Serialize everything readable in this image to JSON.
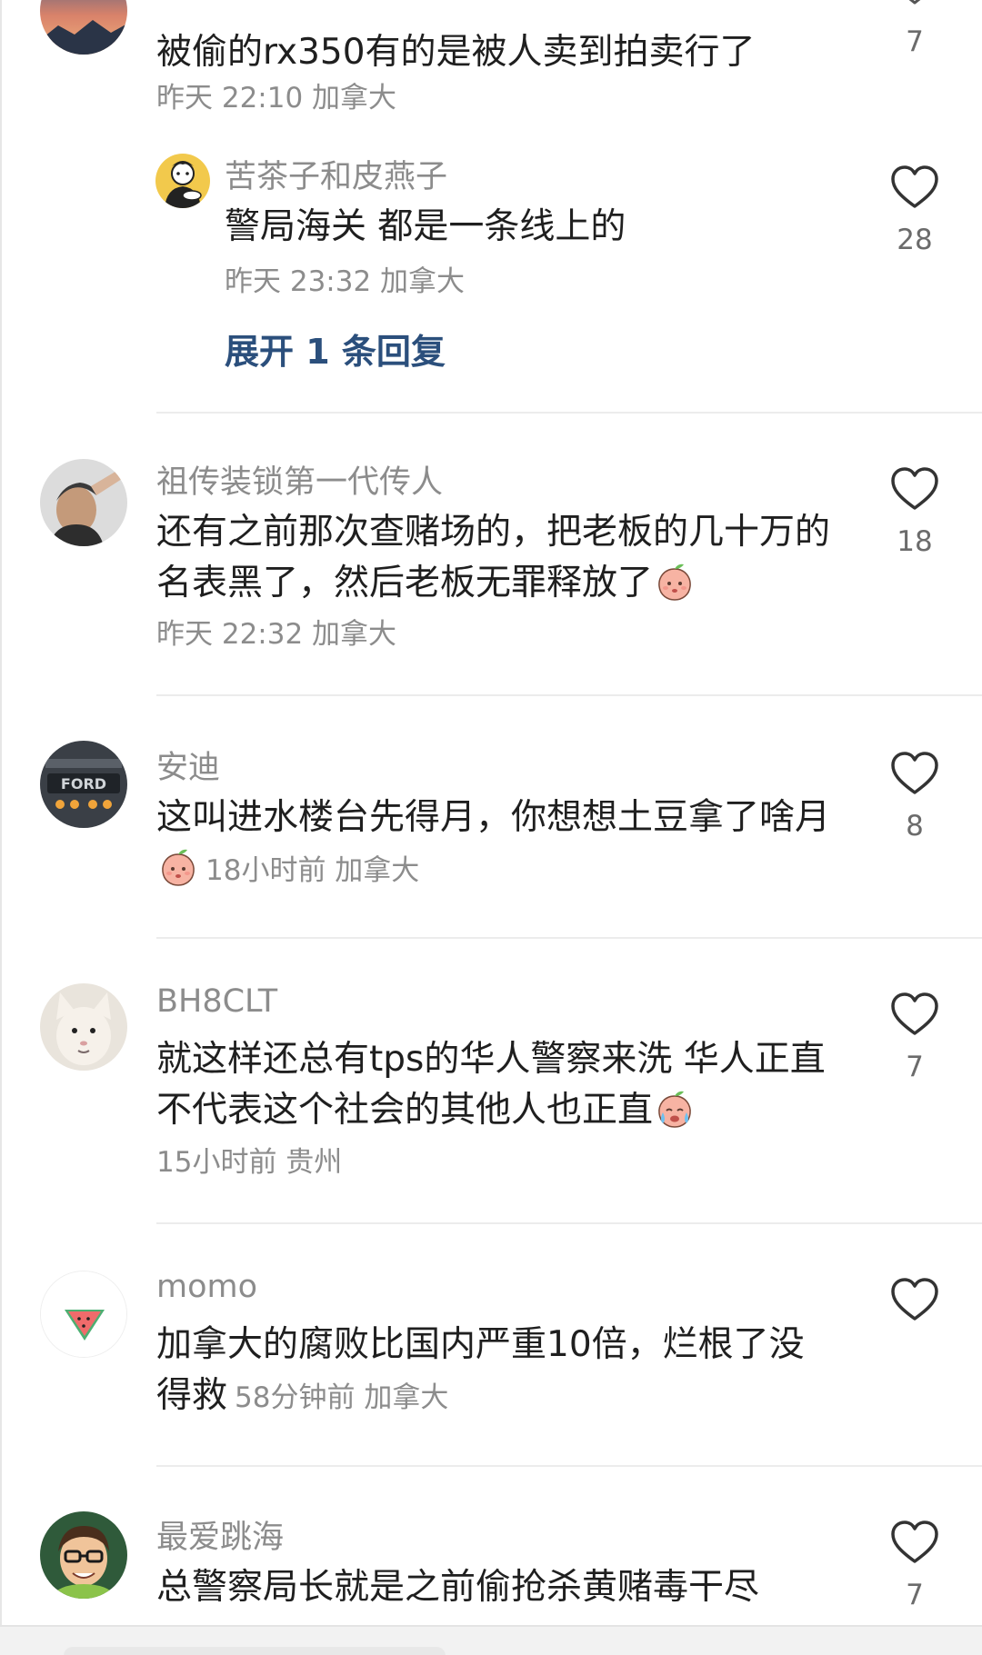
{
  "comments": [
    {
      "text": "被偷的rx350有的是被人卖到拍卖行了",
      "meta": "昨天 22:10 加拿大",
      "likes": "7",
      "replies": [
        {
          "username": "苦茶子和皮燕子",
          "text": "警局海关 都是一条线上的",
          "meta": "昨天 23:32 加拿大",
          "likes": "28"
        }
      ],
      "expand_label": "展开 1 条回复"
    },
    {
      "username": "祖传装锁第一代传人",
      "text": "还有之前那次查赌场的，把老板的几十万的名表黑了，然后老板无罪释放了",
      "meta": "昨天 22:32 加拿大",
      "likes": "18"
    },
    {
      "username": "安迪",
      "text": "这叫进水楼台先得月，你想想土豆拿了啥月",
      "meta": "18小时前  加拿大",
      "likes": "8"
    },
    {
      "username": "BH8CLT",
      "text": "就这样还总有tps的华人警察来洗 华人正直不代表这个社会的其他人也正直",
      "meta": "15小时前  贵州",
      "likes": "7"
    },
    {
      "username": "momo",
      "text": "加拿大的腐败比国内严重10倍，烂根了没得救",
      "meta": "58分钟前  加拿大",
      "likes": ""
    },
    {
      "username": "最爱跳海",
      "text": "总警察局长就是之前偷抢杀黄赌毒干尽",
      "likes": "7"
    }
  ],
  "icons": {
    "like": "heart-outline-icon",
    "emoji_peach": "peach-face-emoji-icon",
    "emoji_crying": "crying-face-emoji-icon"
  },
  "colors": {
    "text": "#1f1f1f",
    "secondary": "#8c8c8c",
    "link": "#2b4f7c",
    "divider": "#ececec"
  }
}
